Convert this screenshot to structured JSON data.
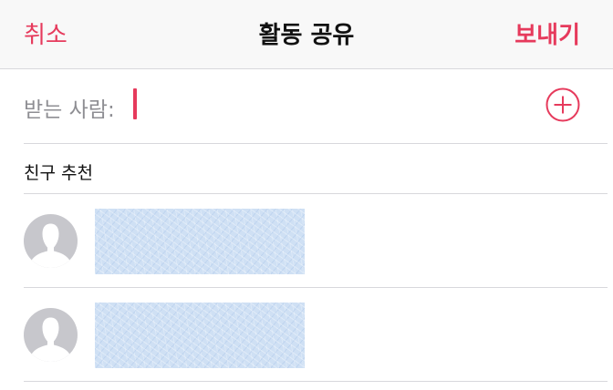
{
  "nav": {
    "cancel_label": "취소",
    "title": "활동 공유",
    "send_label": "보내기"
  },
  "recipient": {
    "label": "받는 사람:",
    "value": ""
  },
  "suggestions": {
    "header": "친구 추천",
    "contacts": [
      {
        "name": "",
        "avatar_icon": "person-silhouette-icon"
      },
      {
        "name": "",
        "avatar_icon": "person-silhouette-icon"
      }
    ]
  },
  "colors": {
    "accent": "#e63a5c",
    "nav_background": "#f8f8f8",
    "separator": "#d8d8dc",
    "avatar": "#c7c7cc"
  }
}
